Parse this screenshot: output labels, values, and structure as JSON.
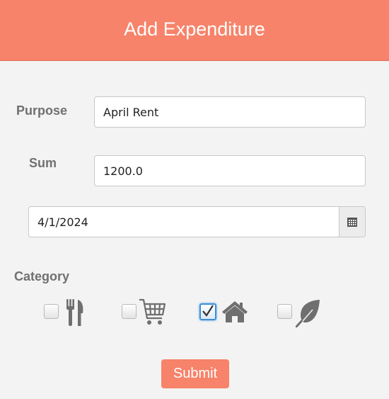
{
  "header": {
    "title": "Add Expenditure"
  },
  "form": {
    "purpose_label": "Purpose",
    "purpose_value": "April Rent",
    "sum_label": "Sum",
    "sum_value": "1200.0",
    "date_value": "4/1/2024",
    "category_label": "Category",
    "categories": [
      {
        "icon": "fork-knife-icon",
        "checked": false
      },
      {
        "icon": "shopping-cart-icon",
        "checked": false
      },
      {
        "icon": "home-icon",
        "checked": true
      },
      {
        "icon": "leaf-icon",
        "checked": false
      }
    ]
  },
  "actions": {
    "submit_label": "Submit"
  },
  "colors": {
    "accent": "#f7836a",
    "icon": "#6f6f6f",
    "label": "#707070",
    "checked_border": "#3d8fd8",
    "background": "#f3f3f3"
  }
}
